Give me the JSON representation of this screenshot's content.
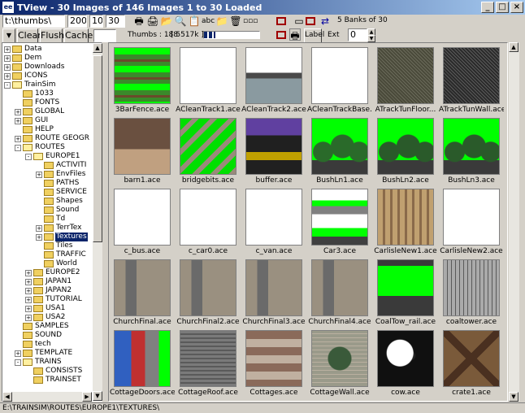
{
  "window": {
    "title": "TView - 30 Images of 146  Images 1 to 30 Loaded",
    "icon": "app-icon",
    "icon_glyph": "ee"
  },
  "toolbar1": {
    "path": "t:\\thumbs\\",
    "width": "200",
    "height": "100",
    "depth": "30",
    "banks": "5 Banks of 30"
  },
  "toolbar2": {
    "clear": "Clear",
    "flush": "Flush",
    "cache": "Cache",
    "thumbs": "Thumbs : 188",
    "size": "[ 5517k ]",
    "label": "Label",
    "ext": "Ext",
    "ext_value": "0",
    "progress": 0.2
  },
  "tree": [
    {
      "label": "Data",
      "depth": 0,
      "exp": "+"
    },
    {
      "label": "Dem",
      "depth": 0,
      "exp": "+"
    },
    {
      "label": "Downloads",
      "depth": 0,
      "exp": "+"
    },
    {
      "label": "ICONS",
      "depth": 0,
      "exp": "+"
    },
    {
      "label": "TrainSim",
      "depth": 0,
      "exp": "-",
      "open": true
    },
    {
      "label": "1033",
      "depth": 1,
      "exp": ""
    },
    {
      "label": "FONTS",
      "depth": 1,
      "exp": ""
    },
    {
      "label": "GLOBAL",
      "depth": 1,
      "exp": "+"
    },
    {
      "label": "GUI",
      "depth": 1,
      "exp": "+"
    },
    {
      "label": "HELP",
      "depth": 1,
      "exp": ""
    },
    {
      "label": "ROUTE GEOGR",
      "depth": 1,
      "exp": "+"
    },
    {
      "label": "ROUTES",
      "depth": 1,
      "exp": "-",
      "open": true
    },
    {
      "label": "EUROPE1",
      "depth": 2,
      "exp": "-",
      "open": true
    },
    {
      "label": "ACTIVITI",
      "depth": 3,
      "exp": ""
    },
    {
      "label": "EnvFiles",
      "depth": 3,
      "exp": "+"
    },
    {
      "label": "PATHS",
      "depth": 3,
      "exp": ""
    },
    {
      "label": "SERVICE",
      "depth": 3,
      "exp": ""
    },
    {
      "label": "Shapes",
      "depth": 3,
      "exp": ""
    },
    {
      "label": "Sound",
      "depth": 3,
      "exp": ""
    },
    {
      "label": "Td",
      "depth": 3,
      "exp": ""
    },
    {
      "label": "TerrTex",
      "depth": 3,
      "exp": "+"
    },
    {
      "label": "Textures",
      "depth": 3,
      "exp": "+",
      "selected": true
    },
    {
      "label": "Tiles",
      "depth": 3,
      "exp": ""
    },
    {
      "label": "TRAFFIC",
      "depth": 3,
      "exp": ""
    },
    {
      "label": "World",
      "depth": 3,
      "exp": ""
    },
    {
      "label": "EUROPE2",
      "depth": 2,
      "exp": "+"
    },
    {
      "label": "JAPAN1",
      "depth": 2,
      "exp": "+"
    },
    {
      "label": "JAPAN2",
      "depth": 2,
      "exp": "+"
    },
    {
      "label": "TUTORIAL",
      "depth": 2,
      "exp": "+"
    },
    {
      "label": "USA1",
      "depth": 2,
      "exp": "+"
    },
    {
      "label": "USA2",
      "depth": 2,
      "exp": "+"
    },
    {
      "label": "SAMPLES",
      "depth": 1,
      "exp": ""
    },
    {
      "label": "SOUND",
      "depth": 1,
      "exp": ""
    },
    {
      "label": "tech",
      "depth": 1,
      "exp": ""
    },
    {
      "label": "TEMPLATE",
      "depth": 1,
      "exp": "+"
    },
    {
      "label": "TRAINS",
      "depth": 1,
      "exp": "-",
      "open": true
    },
    {
      "label": "CONSISTS",
      "depth": 2,
      "exp": ""
    },
    {
      "label": "TRAINSET",
      "depth": 2,
      "exp": ""
    }
  ],
  "thumbs": [
    {
      "name": "3BarFence.ace",
      "bg": "#3a8a2a",
      "fg": "#00ff00",
      "pattern": "bars"
    },
    {
      "name": "ACleanTrack1.ace",
      "bg": "#ffffff",
      "fg": "#ffffff",
      "pattern": "plain"
    },
    {
      "name": "ACleanTrack2.ace",
      "bg": "#8a9aa0",
      "fg": "#ffffff",
      "pattern": "split"
    },
    {
      "name": "ACleanTrackBase...",
      "bg": "#ffffff",
      "fg": "#ffffff",
      "pattern": "plain"
    },
    {
      "name": "ATrackTunFloor...",
      "bg": "#4a4a3a",
      "fg": "#6a6a5a",
      "pattern": "noise"
    },
    {
      "name": "ATrackTunWall.ace",
      "bg": "#2a2a2a",
      "fg": "#5a5a5a",
      "pattern": "noise"
    },
    {
      "name": "barn1.ace",
      "bg": "#6a5040",
      "fg": "#c0a080",
      "pattern": "planks"
    },
    {
      "name": "bridgebits.ace",
      "bg": "#00e000",
      "fg": "#9a8a7a",
      "pattern": "bridge"
    },
    {
      "name": "buffer.ace",
      "bg": "#202020",
      "fg": "#c0a000",
      "pattern": "buffer"
    },
    {
      "name": "BushLn1.ace",
      "bg": "#00ff00",
      "fg": "#2a6a2a",
      "pattern": "trees"
    },
    {
      "name": "BushLn2.ace",
      "bg": "#00ff00",
      "fg": "#2a5a2a",
      "pattern": "trees"
    },
    {
      "name": "BushLn3.ace",
      "bg": "#00ff00",
      "fg": "#2a5a2a",
      "pattern": "trees"
    },
    {
      "name": "c_bus.ace",
      "bg": "#ffffff",
      "fg": "#ffffff",
      "pattern": "plain"
    },
    {
      "name": "c_car0.ace",
      "bg": "#ffffff",
      "fg": "#ffffff",
      "pattern": "plain"
    },
    {
      "name": "c_van.ace",
      "bg": "#ffffff",
      "fg": "#ffffff",
      "pattern": "plain"
    },
    {
      "name": "Car3.ace",
      "bg": "#c0c0c0",
      "fg": "#00ff00",
      "pattern": "car"
    },
    {
      "name": "CarlisleNew1.ace",
      "bg": "#c0a070",
      "fg": "#8a6a4a",
      "pattern": "windows"
    },
    {
      "name": "CarlisleNew2.ace",
      "bg": "#ffffff",
      "fg": "#ffffff",
      "pattern": "plain"
    },
    {
      "name": "ChurchFinal.ace",
      "bg": "#6a6a6a",
      "fg": "#9a9080",
      "pattern": "church"
    },
    {
      "name": "ChurchFinal2.ace",
      "bg": "#6a6a6a",
      "fg": "#9a9080",
      "pattern": "church"
    },
    {
      "name": "ChurchFinal3.ace",
      "bg": "#6a6a6a",
      "fg": "#9a9080",
      "pattern": "church"
    },
    {
      "name": "ChurchFinal4.ace",
      "bg": "#6a6a6a",
      "fg": "#9a9080",
      "pattern": "church"
    },
    {
      "name": "CoalTow_rail.ace",
      "bg": "#3a3a3a",
      "fg": "#00ff00",
      "pattern": "coal"
    },
    {
      "name": "coaltower.ace",
      "bg": "#aaaaaa",
      "fg": "#5a5a5a",
      "pattern": "tower"
    },
    {
      "name": "CottageDoors.ace",
      "bg": "#00ff00",
      "fg": "#c03030",
      "pattern": "doors"
    },
    {
      "name": "CottageRoof.ace",
      "bg": "#7a7a7a",
      "fg": "#5a5a5a",
      "pattern": "roof"
    },
    {
      "name": "Cottages.ace",
      "bg": "#8a6a5a",
      "fg": "#c0b0a0",
      "pattern": "cottages"
    },
    {
      "name": "CottageWall.ace",
      "bg": "#9a9a8a",
      "fg": "#3a5a3a",
      "pattern": "wall"
    },
    {
      "name": "cow.ace",
      "bg": "#101010",
      "fg": "#ffffff",
      "pattern": "cow"
    },
    {
      "name": "crate1.ace",
      "bg": "#7a5a3a",
      "fg": "#4a3020",
      "pattern": "crate"
    }
  ],
  "statusbar": {
    "path": "E:\\TRAINSIM\\ROUTES\\EUROPE1\\TEXTURES\\"
  }
}
